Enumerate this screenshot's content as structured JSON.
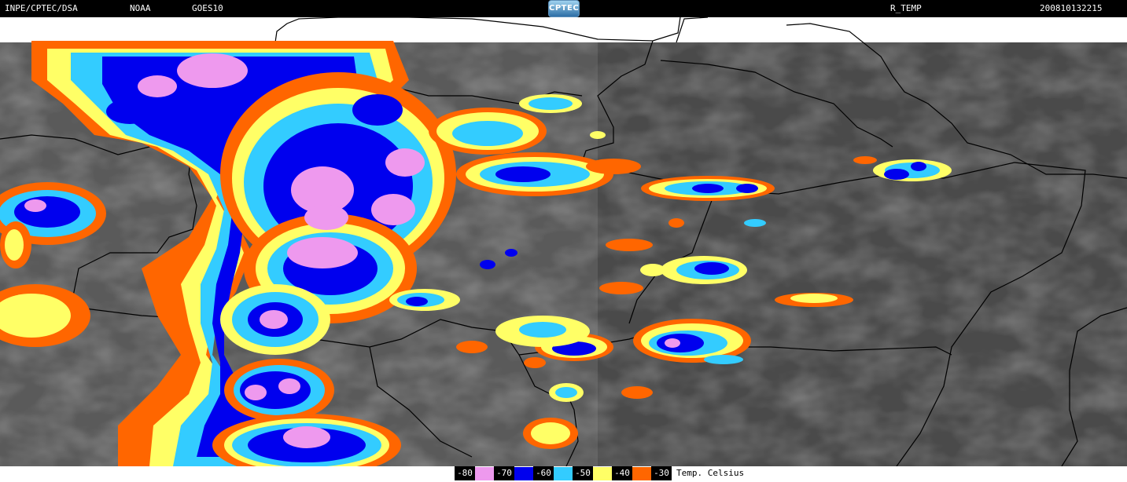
{
  "header": {
    "source": "INPE/CPTEC/DSA",
    "agency": "NOAA",
    "satellite": "GOES10",
    "logo_text": "CPTEC",
    "product": "R_TEMP",
    "datetime": "200810132215"
  },
  "legend": {
    "unit_label": "Temp. Celsius",
    "entries": [
      {
        "label": "-80",
        "color": "#ee99ee"
      },
      {
        "label": "-70",
        "color": "#0000ee"
      },
      {
        "label": "-60",
        "color": "#33ccff"
      },
      {
        "label": "-50",
        "color": "#ffff66"
      },
      {
        "label": "-40",
        "color": "#ff6600"
      },
      {
        "label": "-30",
        "color": ""
      }
    ]
  },
  "colors": {
    "background_cloud": "#4a4a4a",
    "border_line": "#000000"
  }
}
